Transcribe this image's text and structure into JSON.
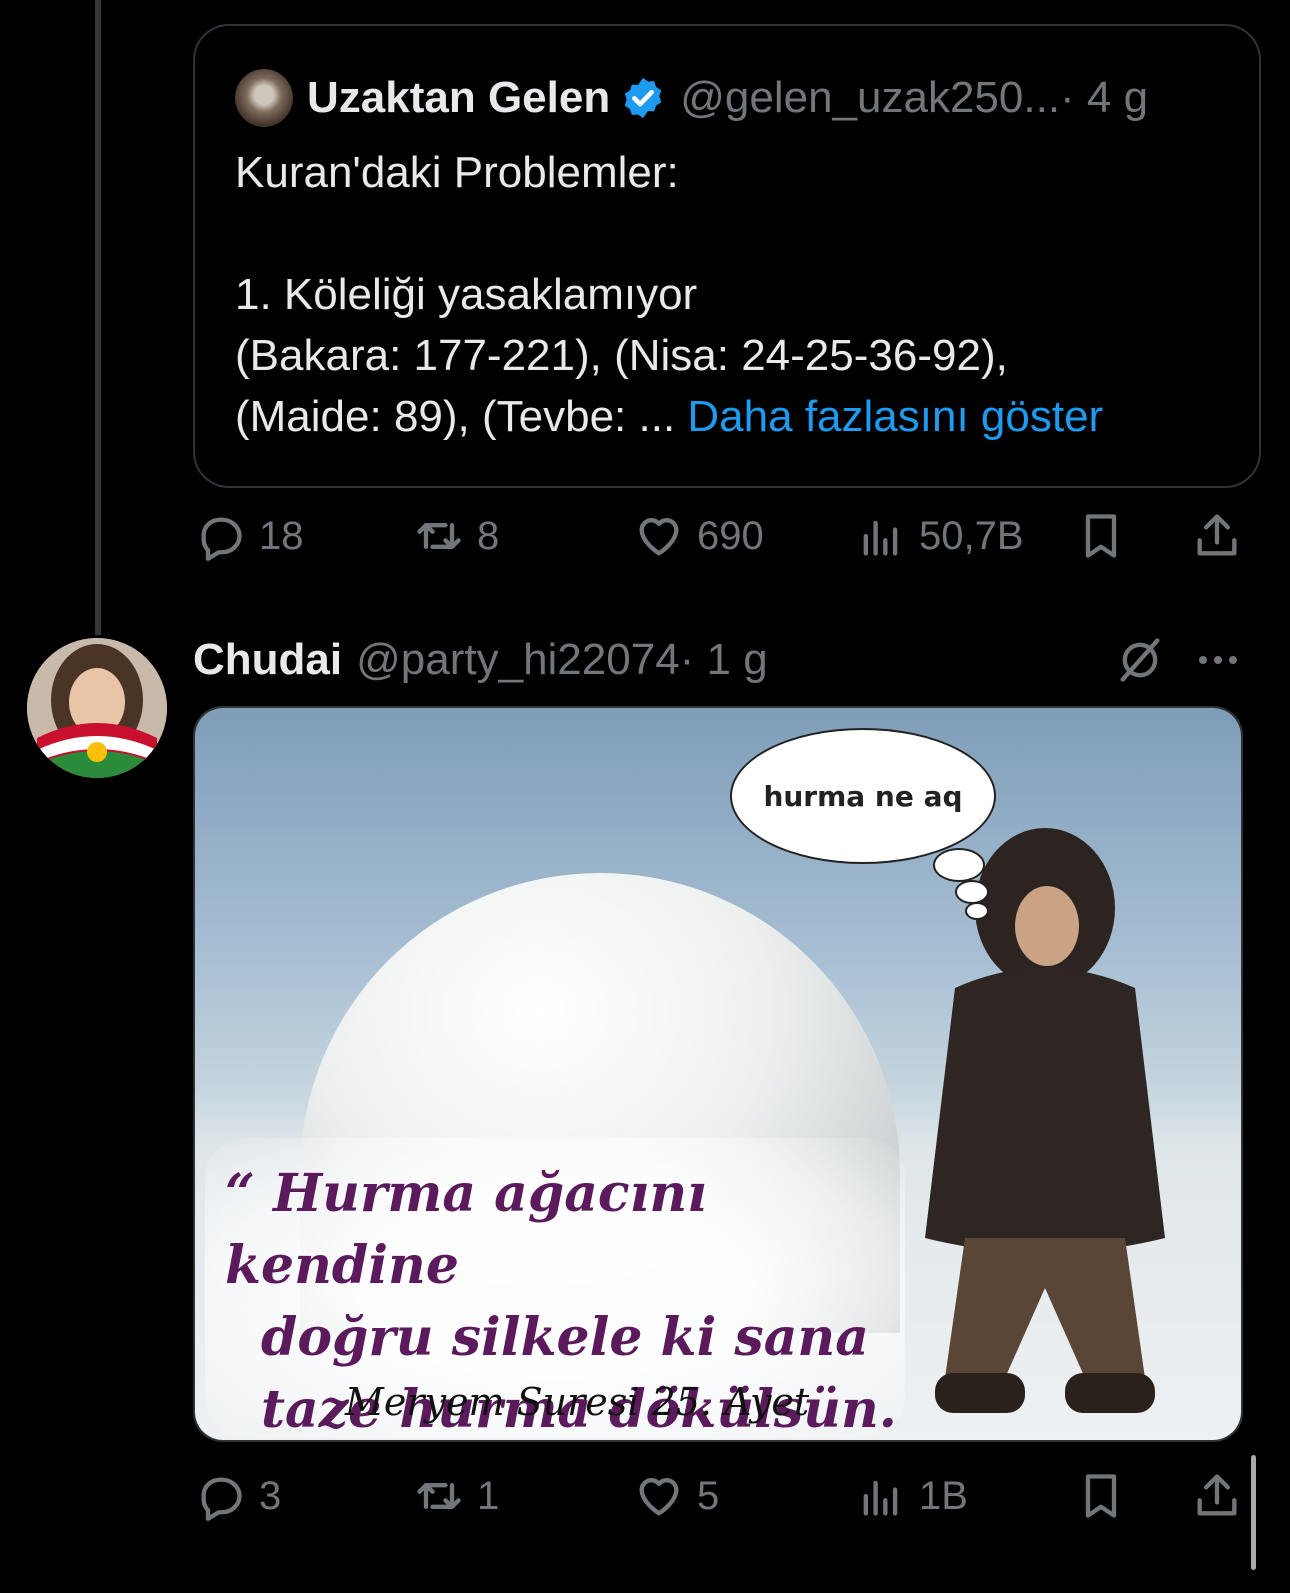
{
  "quoted_tweet": {
    "author_name": "Uzaktan Gelen",
    "handle": "@gelen_uzak250...",
    "time": "· 4 g",
    "lines": [
      "Kuran'daki Problemler:",
      "",
      "1. Köleliği yasaklamıyor",
      "(Bakara: 177-221), (Nisa: 24-25-36-92),",
      "(Maide: 89), (Tevbe: ... "
    ],
    "show_more": "Daha fazlasını göster",
    "verified_color": "#1d9bf0"
  },
  "quoted_actions": {
    "replies": "18",
    "reposts": "8",
    "likes": "690",
    "views": "50,7B"
  },
  "reply_tweet": {
    "author_name": "Chudai",
    "handle": "@party_hi22074",
    "time": "· 1 g",
    "image": {
      "bubble_text": "hurma ne aq",
      "quote_lines": [
        "“ Hurma ağacını kendine",
        "doğru silkele ki sana",
        "taze hurma dökülsün. “"
      ],
      "caption": "Meryem Suresi 25. Ayet"
    }
  },
  "reply_actions": {
    "replies": "3",
    "reposts": "1",
    "likes": "5",
    "views": "1B"
  },
  "icons": {
    "reply": "speech-bubble-icon",
    "repost": "repost-arrows-icon",
    "like": "heart-icon",
    "views": "bar-chart-icon",
    "bookmark": "bookmark-icon",
    "share": "share-upload-icon",
    "grok": "grok-icon",
    "more": "more-dots-icon"
  },
  "colors": {
    "background": "#000000",
    "text": "#e7e9ea",
    "muted": "#71767b",
    "link": "#1d9bf0",
    "border": "#2f3336"
  }
}
